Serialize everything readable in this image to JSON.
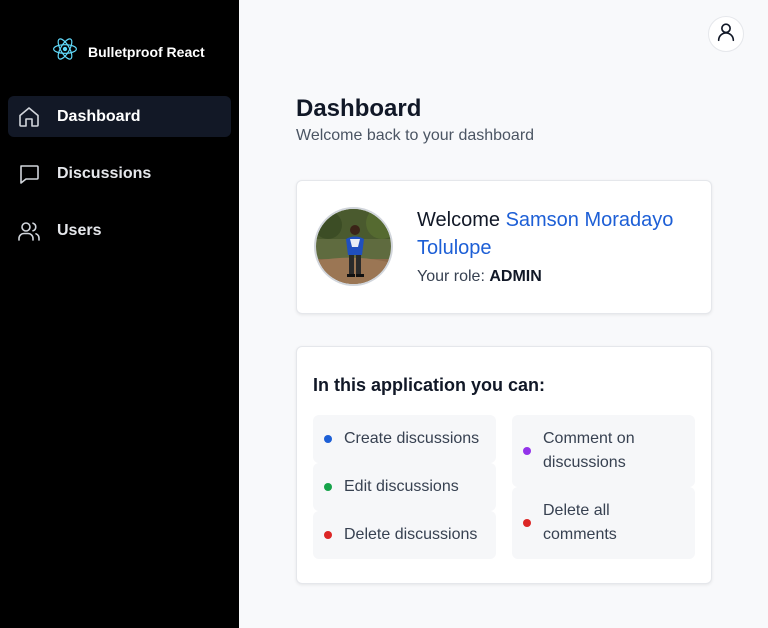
{
  "brand": {
    "title": "Bulletproof React",
    "logo_icon": "react-icon",
    "logo_color": "#61dafb"
  },
  "nav": {
    "items": [
      {
        "label": "Dashboard",
        "icon": "home-icon",
        "active": true
      },
      {
        "label": "Discussions",
        "icon": "chat-icon",
        "active": false
      },
      {
        "label": "Users",
        "icon": "users-icon",
        "active": false
      }
    ]
  },
  "header": {
    "user_icon": "user-icon"
  },
  "page": {
    "title": "Dashboard",
    "subtitle": "Welcome back to your dashboard"
  },
  "welcome": {
    "prefix": "Welcome",
    "name": "Samson Moradayo Tolulope",
    "role_label": "Your role:",
    "role_value": "ADMIN"
  },
  "capabilities": {
    "title": "In this application you can:",
    "items": [
      {
        "label": "Create discussions",
        "color": "#1d5fd6"
      },
      {
        "label": "Edit discussions",
        "color": "#16a34a"
      },
      {
        "label": "Delete discussions",
        "color": "#dc2626"
      },
      {
        "label": "Comment on discussions",
        "color": "#9333ea"
      },
      {
        "label": "Delete all comments",
        "color": "#dc2626"
      }
    ]
  },
  "colors": {
    "accent": "#1d5fd6",
    "sidebar_bg": "#000000",
    "active_nav_bg": "#121826"
  }
}
